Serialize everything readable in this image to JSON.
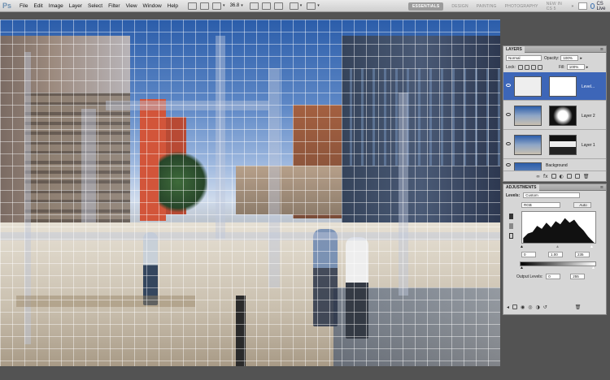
{
  "menubar": {
    "app_logo": "Ps",
    "menus": [
      "File",
      "Edit",
      "Image",
      "Layer",
      "Select",
      "Filter",
      "View",
      "Window",
      "Help"
    ],
    "zoom": "36.8",
    "workspaces": [
      "ESSENTIALS",
      "DESIGN",
      "PAINTING",
      "PHOTOGRAPHY",
      "NEW IN CS 5"
    ],
    "more": "»",
    "cs_live": "CS Live"
  },
  "layers_panel": {
    "tab": "LAYERS",
    "blend_mode": "Normal",
    "opacity_label": "Opacity:",
    "opacity_value": "100%",
    "lock_label": "Lock:",
    "fill_label": "Fill:",
    "fill_value": "100%",
    "layers": [
      {
        "name": "Level...",
        "selected": true
      },
      {
        "name": "Layer 2",
        "selected": false
      },
      {
        "name": "Layer 1",
        "selected": false
      },
      {
        "name": "Background",
        "selected": false
      }
    ]
  },
  "adjustments_panel": {
    "tab": "ADJUSTMENTS",
    "type_label": "Levels:",
    "preset": "Custom",
    "channel": "RGB",
    "auto_button": "Auto",
    "input_black": "0",
    "input_gamma": "1.00",
    "input_white": "235",
    "output_label": "Output Levels:",
    "output_black": "0",
    "output_white": "255"
  },
  "colors": {
    "selection": "#3d66b8",
    "panel_bg": "#d6d6d6",
    "app_bg": "#535353"
  }
}
